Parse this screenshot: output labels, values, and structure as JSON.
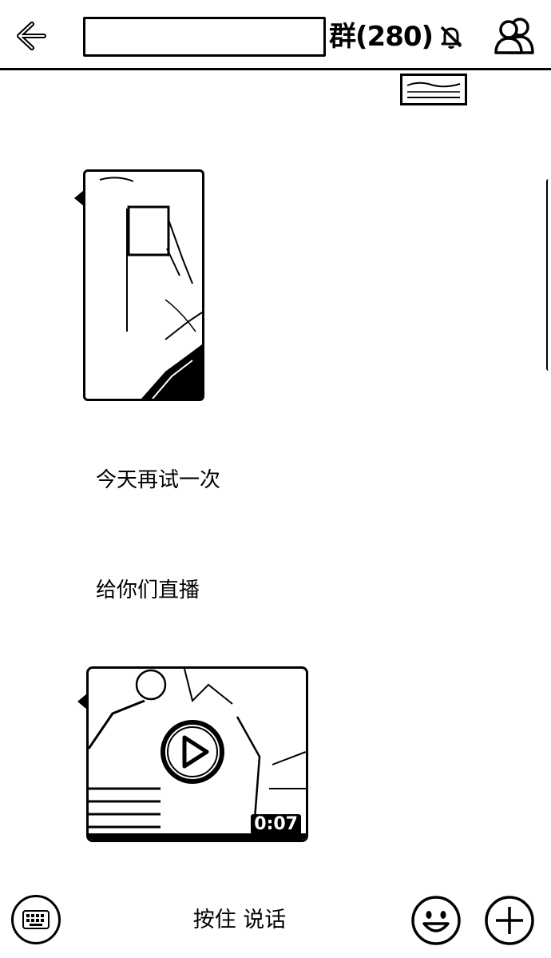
{
  "header": {
    "title_suffix": "群(280)",
    "icons": {
      "back": "arrow-left-icon",
      "mute": "bell-off-icon",
      "members": "group-members-icon"
    }
  },
  "messages": [
    {
      "type": "image"
    },
    {
      "type": "text",
      "text": "今天再试一次"
    },
    {
      "type": "text",
      "text": "给你们直播"
    },
    {
      "type": "video",
      "duration": "0:07"
    }
  ],
  "input_bar": {
    "hold_to_talk_label": "按住 说话",
    "icons": {
      "keyboard": "keyboard-icon",
      "emoji": "smiley-icon",
      "plus": "plus-icon"
    }
  }
}
